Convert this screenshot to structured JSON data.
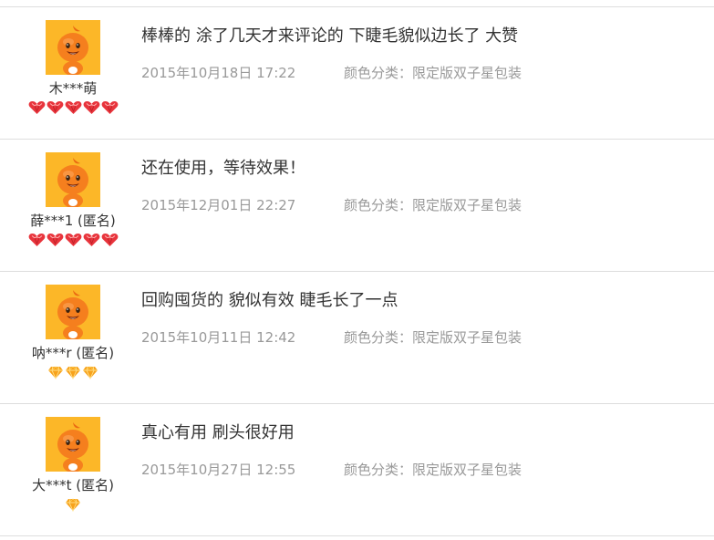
{
  "reviews": [
    {
      "user": "木***萌",
      "rank": {
        "type": "heart",
        "count": 5
      },
      "comment": "棒棒的 涂了几天才来评论的 下睫毛貌似边长了 大赞",
      "date": "2015年10月18日 17:22",
      "sku_label": "颜色分类：",
      "sku_value": "限定版双子星包装"
    },
    {
      "user": "薛***1 (匿名)",
      "rank": {
        "type": "heart",
        "count": 5
      },
      "comment": "还在使用，等待效果！",
      "date": "2015年12月01日 22:27",
      "sku_label": "颜色分类：",
      "sku_value": "限定版双子星包装"
    },
    {
      "user": "呐***r (匿名)",
      "rank": {
        "type": "diamond",
        "count": 3
      },
      "comment": "回购囤货的 貌似有效 睫毛长了一点",
      "date": "2015年10月11日 12:42",
      "sku_label": "颜色分类：",
      "sku_value": "限定版双子星包装"
    },
    {
      "user": "大***t (匿名)",
      "rank": {
        "type": "diamond",
        "count": 1
      },
      "comment": "真心有用 刷头很好用",
      "date": "2015年10月27日 12:55",
      "sku_label": "颜色分类：",
      "sku_value": "限定版双子星包装"
    }
  ],
  "colors": {
    "avatar_bg": "#fbb01d",
    "heart": "#e8343c",
    "diamond": "#f7a21b"
  },
  "icons": {
    "avatar": "orange-mascot-avatar-icon",
    "heart": "red-heart-gem-icon",
    "diamond": "yellow-diamond-icon"
  }
}
